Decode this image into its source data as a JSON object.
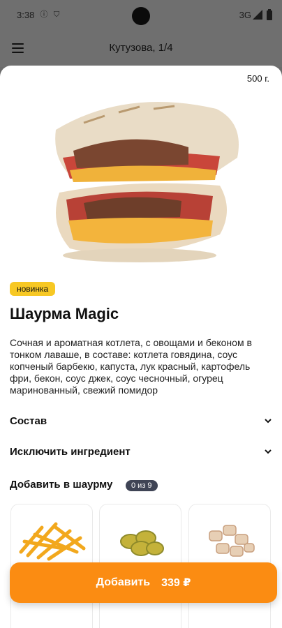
{
  "status_bar": {
    "time": "3:38",
    "network": "3G"
  },
  "header": {
    "title": "Кутузова,  1/4"
  },
  "product": {
    "weight": "500 г.",
    "badge": "новинка",
    "title": "Шаурма Magic",
    "description": "Сочная и ароматная котлета, с овощами и беконом в тонком лаваше, в составе: котлета говядина, соус копченый барбекю, капуста, лук красный, картофель фри, бекон, соус джек, соус чесночный, огурец маринованный, свежий помидор"
  },
  "sections": {
    "composition": "Состав",
    "exclude": "Исключить ингредиент"
  },
  "addons": {
    "title": "Добавить в шаурму",
    "counter": "0 из 9",
    "items": [
      {
        "icon": "fries-icon",
        "caption": ""
      },
      {
        "icon": "pickles-icon",
        "caption": ""
      },
      {
        "icon": "chicken-icon",
        "caption": ""
      }
    ]
  },
  "cta": {
    "label": "Добавить",
    "price": "339 ₽"
  },
  "colors": {
    "accent": "#fb8c12",
    "badge": "#f7c824",
    "counter": "#3f4455"
  }
}
